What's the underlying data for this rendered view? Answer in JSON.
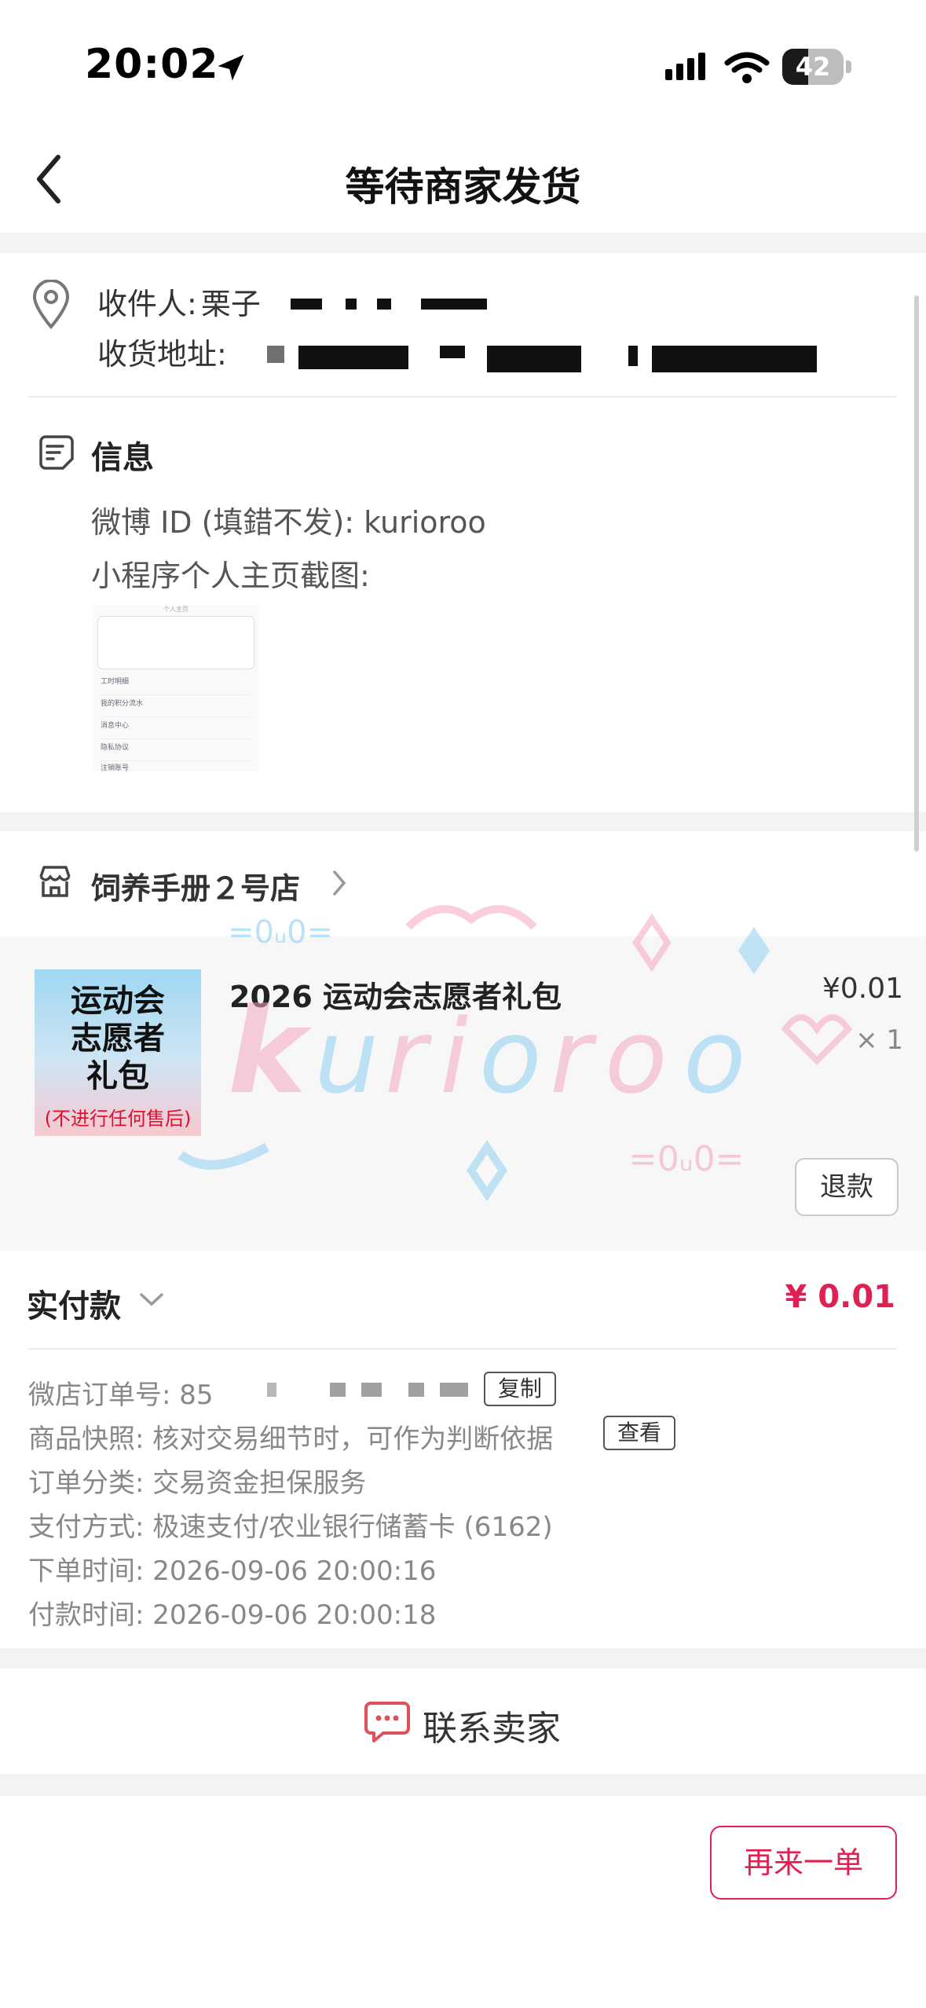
{
  "status_bar": {
    "time": "20:02",
    "battery": "42",
    "battery_level": 0.42
  },
  "nav": {
    "title": "等待商家发货"
  },
  "address": {
    "recipient_label": "收件人:",
    "recipient_value": "栗子",
    "address_label": "收货地址:"
  },
  "info": {
    "title": "信息",
    "weibo": "微博 ID (填錯不发): kurioroo",
    "screenshot_label": "小程序个人主页截图:",
    "thumbnail": {
      "header": "个人主页",
      "rows": [
        "工时明细",
        "我的积分流水",
        "消息中心",
        "隐私协议",
        "注销账号"
      ]
    }
  },
  "shop": {
    "name": "饲养手册２号店"
  },
  "item": {
    "image_line1": "运动会",
    "image_line2": "志愿者",
    "image_line3": "礼包",
    "image_sub": "(不进行任何售后)",
    "title": "2026 运动会志愿者礼包",
    "price": "¥0.01",
    "qty": "× 1",
    "refund_label": "退款",
    "watermark_text": "kurioroo"
  },
  "payment": {
    "paid_label": "实付款",
    "paid_amount": "¥ 0.01",
    "order_no_label": "微店订单号:",
    "order_no_value": "85",
    "copy_label": "复制",
    "snapshot_label": "商品快照:",
    "snapshot_value": "核对交易细节时，可作为判断依据",
    "view_label": "查看",
    "category_label": "订单分类:",
    "category_value": "交易资金担保服务",
    "method_label": "支付方式:",
    "method_value": "极速支付/农业银行储蓄卡 (6162)",
    "order_time_label": "下单时间:",
    "order_time_value": "2026-09-06 20:00:16",
    "pay_time_label": "付款时间:",
    "pay_time_value": "2026-09-06 20:00:18"
  },
  "contact": {
    "label": "联系卖家"
  },
  "bottom": {
    "reorder_label": "再来一单"
  },
  "colors": {
    "accent": "#e02052",
    "background": "#f3f3f3"
  },
  "icons": {
    "back": "chevron-left-icon",
    "location_pin": "map-pin-icon",
    "info": "note-icon",
    "shop": "storefront-icon",
    "contact": "chat-bubble-icon"
  }
}
